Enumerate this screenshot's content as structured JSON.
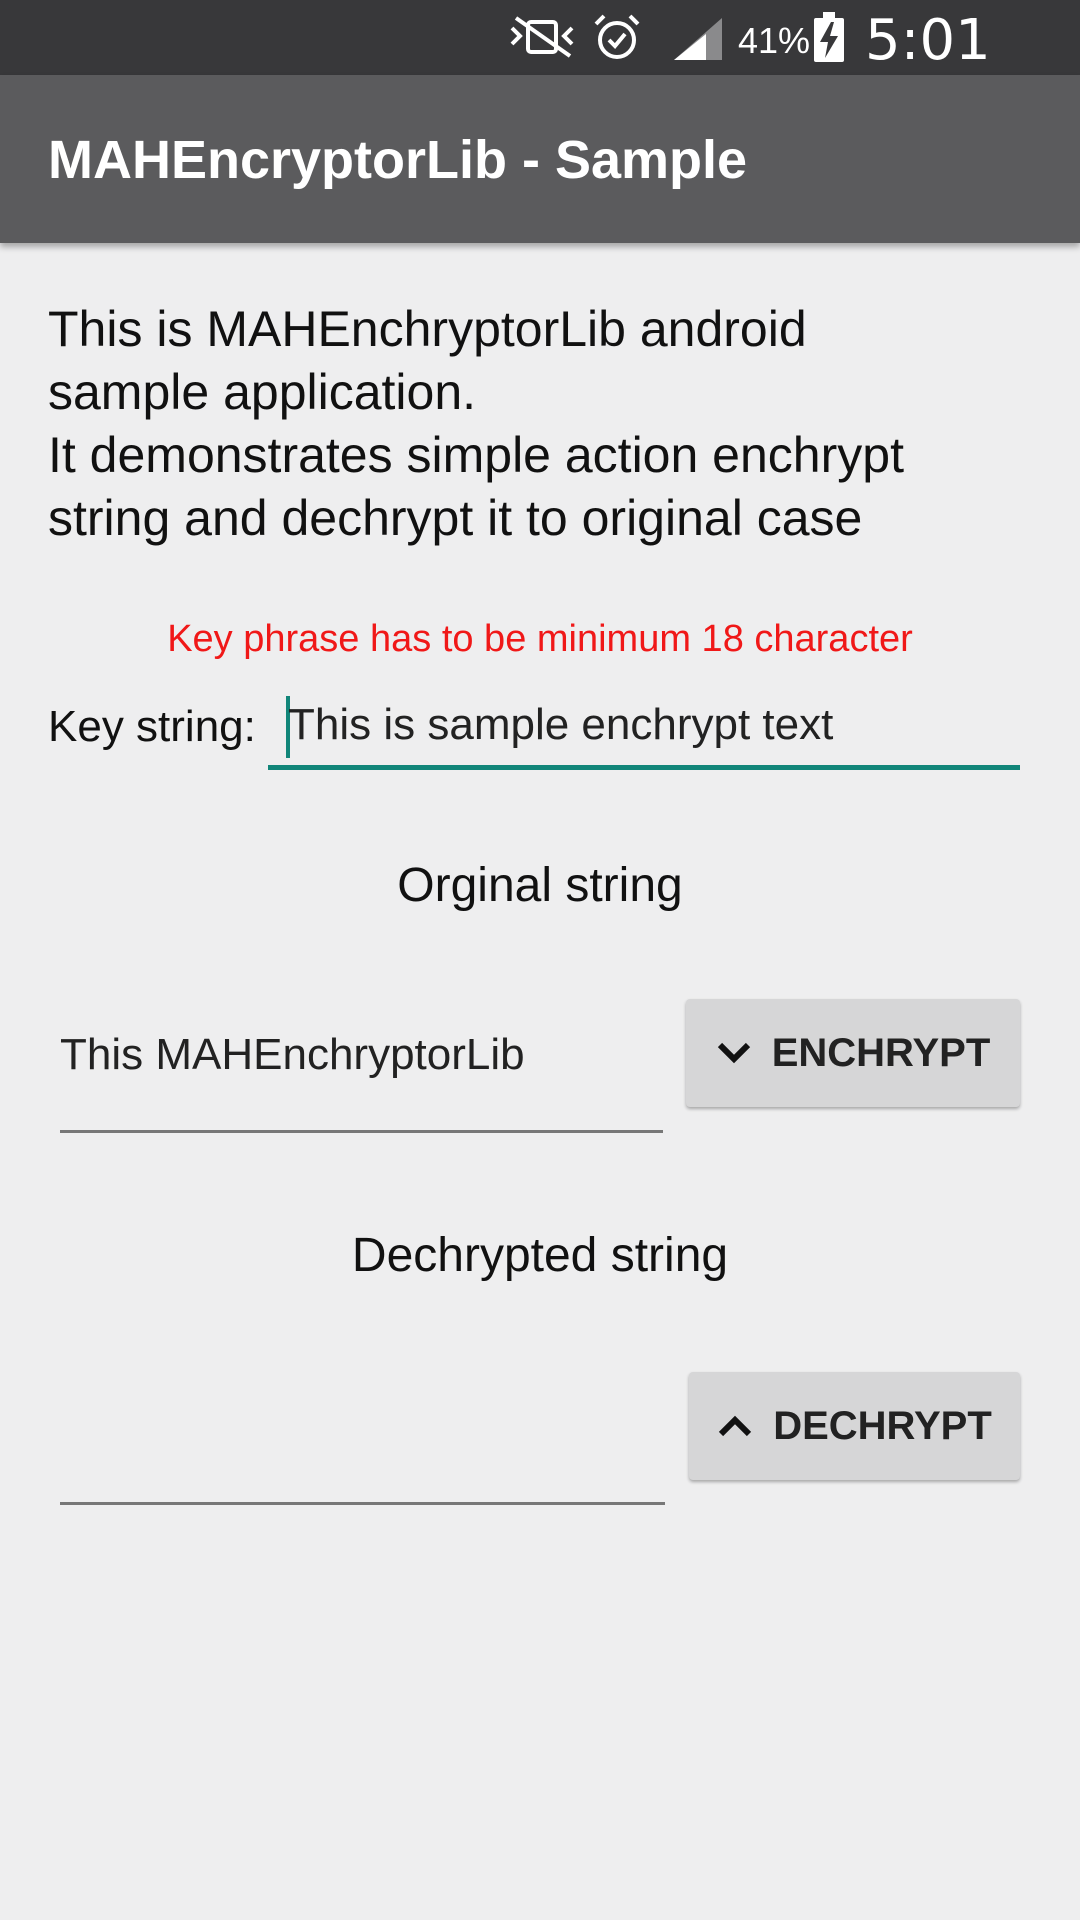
{
  "status_bar": {
    "icons": [
      "vibrate-mute-icon",
      "alarm-icon",
      "signal-icon",
      "battery-charging-icon"
    ],
    "battery_percent": "41%",
    "time": "5:01 PM"
  },
  "app_bar": {
    "title": "MAHEncryptorLib - Sample"
  },
  "intro": {
    "lines": [
      "This is MAHEnchryptorLib android",
      "sample application.",
      "It demonstrates simple action enchrypt",
      "string and dechrypt it to original case"
    ]
  },
  "warning": {
    "text": "Key phrase has to be minimum 18 character",
    "color": "#f01818"
  },
  "key": {
    "label": "Key string:",
    "value": "This is sample enchrypt text",
    "accent": "#118579"
  },
  "original": {
    "title": "Orginal string",
    "value": "This MAHEnchryptorLib",
    "button_label": "ENCHRYPT",
    "button_icon": "chevron-down-icon"
  },
  "decrypted": {
    "title": "Dechrypted string",
    "value": "",
    "button_label": "DECHRYPT",
    "button_icon": "chevron-up-icon"
  }
}
